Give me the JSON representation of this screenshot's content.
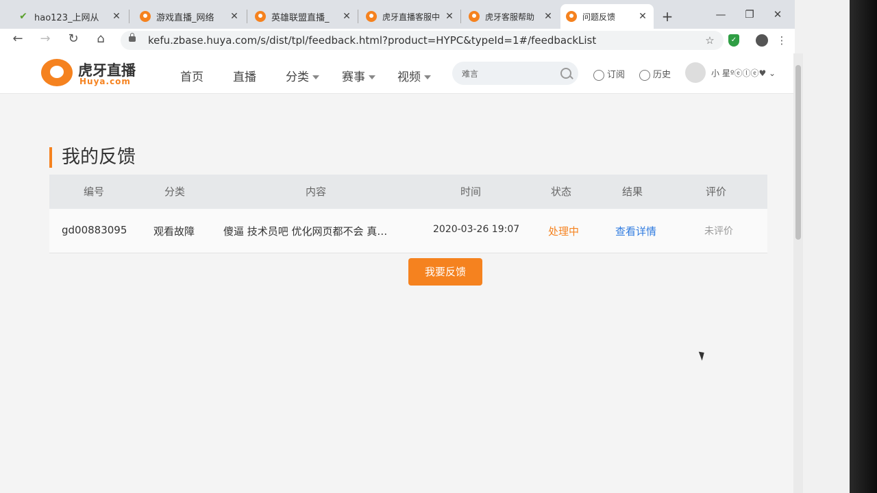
{
  "tabs": [
    {
      "title": "hao123_上网从",
      "icon": "hao123-icon"
    },
    {
      "title": "游戏直播_网络",
      "icon": "huya-icon"
    },
    {
      "title": "英雄联盟直播_",
      "icon": "huya-icon"
    },
    {
      "title": "虎牙直播客服中",
      "icon": "huya-icon"
    },
    {
      "title": "虎牙客服帮助",
      "icon": "huya-icon"
    },
    {
      "title": "问题反馈",
      "icon": "huya-icon",
      "active": true
    }
  ],
  "browser": {
    "url": "kefu.zbase.huya.com/s/dist/tpl/feedback.html?product=HYPC&typeId=1#/feedbackList"
  },
  "header": {
    "logo_cn": "虎牙直播",
    "logo_en": "Huya.com",
    "nav": [
      "首页",
      "直播",
      "分类",
      "赛事",
      "视频"
    ],
    "search_placeholder": "难言",
    "subscribe": "订阅",
    "history": "历史",
    "username": "小 星ºⓔⓛⓔ♥"
  },
  "page": {
    "title": "我的反馈",
    "columns": [
      "编号",
      "分类",
      "内容",
      "时间",
      "状态",
      "结果",
      "评价"
    ],
    "rows": [
      {
        "id": "gd00883095",
        "category": "观看故障",
        "content": "傻逼 技术员吧 优化网页都不会 真…",
        "time": "2020-03-26 19:07",
        "status": "处理中",
        "result": "查看详情",
        "rating": "未评价"
      }
    ],
    "feedback_button": "我要反馈"
  },
  "colors": {
    "brand_orange": "#f5821f",
    "link_blue": "#2f7be0"
  }
}
